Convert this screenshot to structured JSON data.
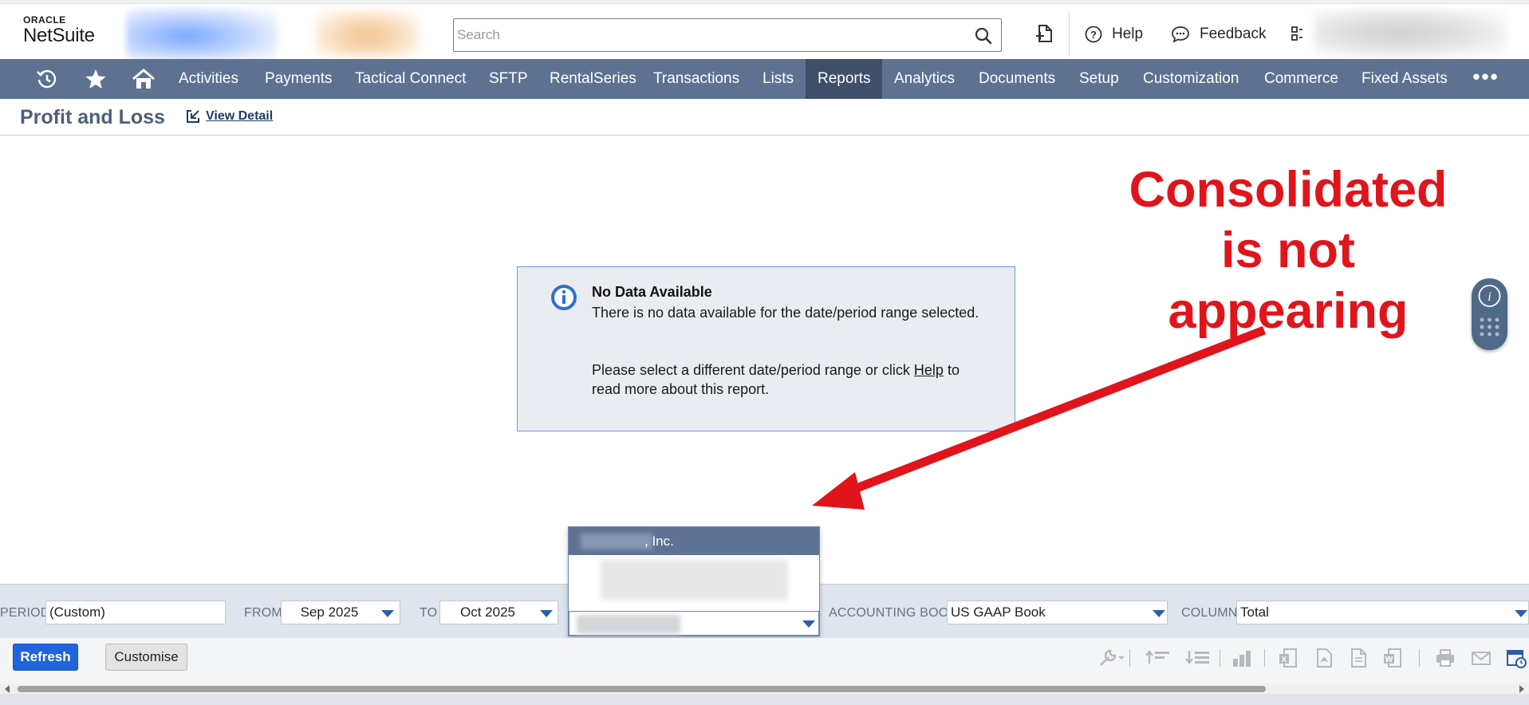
{
  "header": {
    "logo_oracle": "ORACLE",
    "logo_netsuite": "NetSuite",
    "search_placeholder": "Search",
    "help_label": "Help",
    "feedback_label": "Feedback"
  },
  "nav": {
    "items": [
      {
        "label": "Activities"
      },
      {
        "label": "Payments"
      },
      {
        "label": "Tactical Connect"
      },
      {
        "label": "SFTP"
      },
      {
        "label": "RentalSeries"
      },
      {
        "label": "Transactions"
      },
      {
        "label": "Lists"
      },
      {
        "label": "Reports",
        "active": true
      },
      {
        "label": "Analytics"
      },
      {
        "label": "Documents"
      },
      {
        "label": "Setup"
      },
      {
        "label": "Customization"
      },
      {
        "label": "Commerce"
      },
      {
        "label": "Fixed Assets"
      }
    ],
    "more_label": "•••"
  },
  "page": {
    "title": "Profit and Loss",
    "view_detail": "View Detail"
  },
  "message": {
    "title": "No Data Available",
    "line1": "There is no data available for the date/period range selected.",
    "line2_pre": "Please select a different date/period range or click ",
    "line2_link": "Help",
    "line2_post": " to read more about this report."
  },
  "annotation": {
    "text": "Consolidated is not appearing",
    "color": "#e0141b"
  },
  "filters": {
    "period_label": "PERIOD",
    "period_value": "(Custom)",
    "from_label": "FROM",
    "from_value": "Sep 2025",
    "to_label": "TO",
    "to_value": "Oct 2025",
    "subsidiary_option_visible": ", Inc.",
    "accounting_book_label": "ACCOUNTING BOOK",
    "accounting_book_value": "US GAAP Book",
    "column_label": "COLUMN",
    "column_value": "Total"
  },
  "actions": {
    "refresh_label": "Refresh",
    "customise_label": "Customise"
  },
  "colors": {
    "nav_bg": "#5c7290",
    "nav_active": "#3e5069",
    "primary_button": "#1f64dc",
    "message_border": "#6f98d8"
  }
}
